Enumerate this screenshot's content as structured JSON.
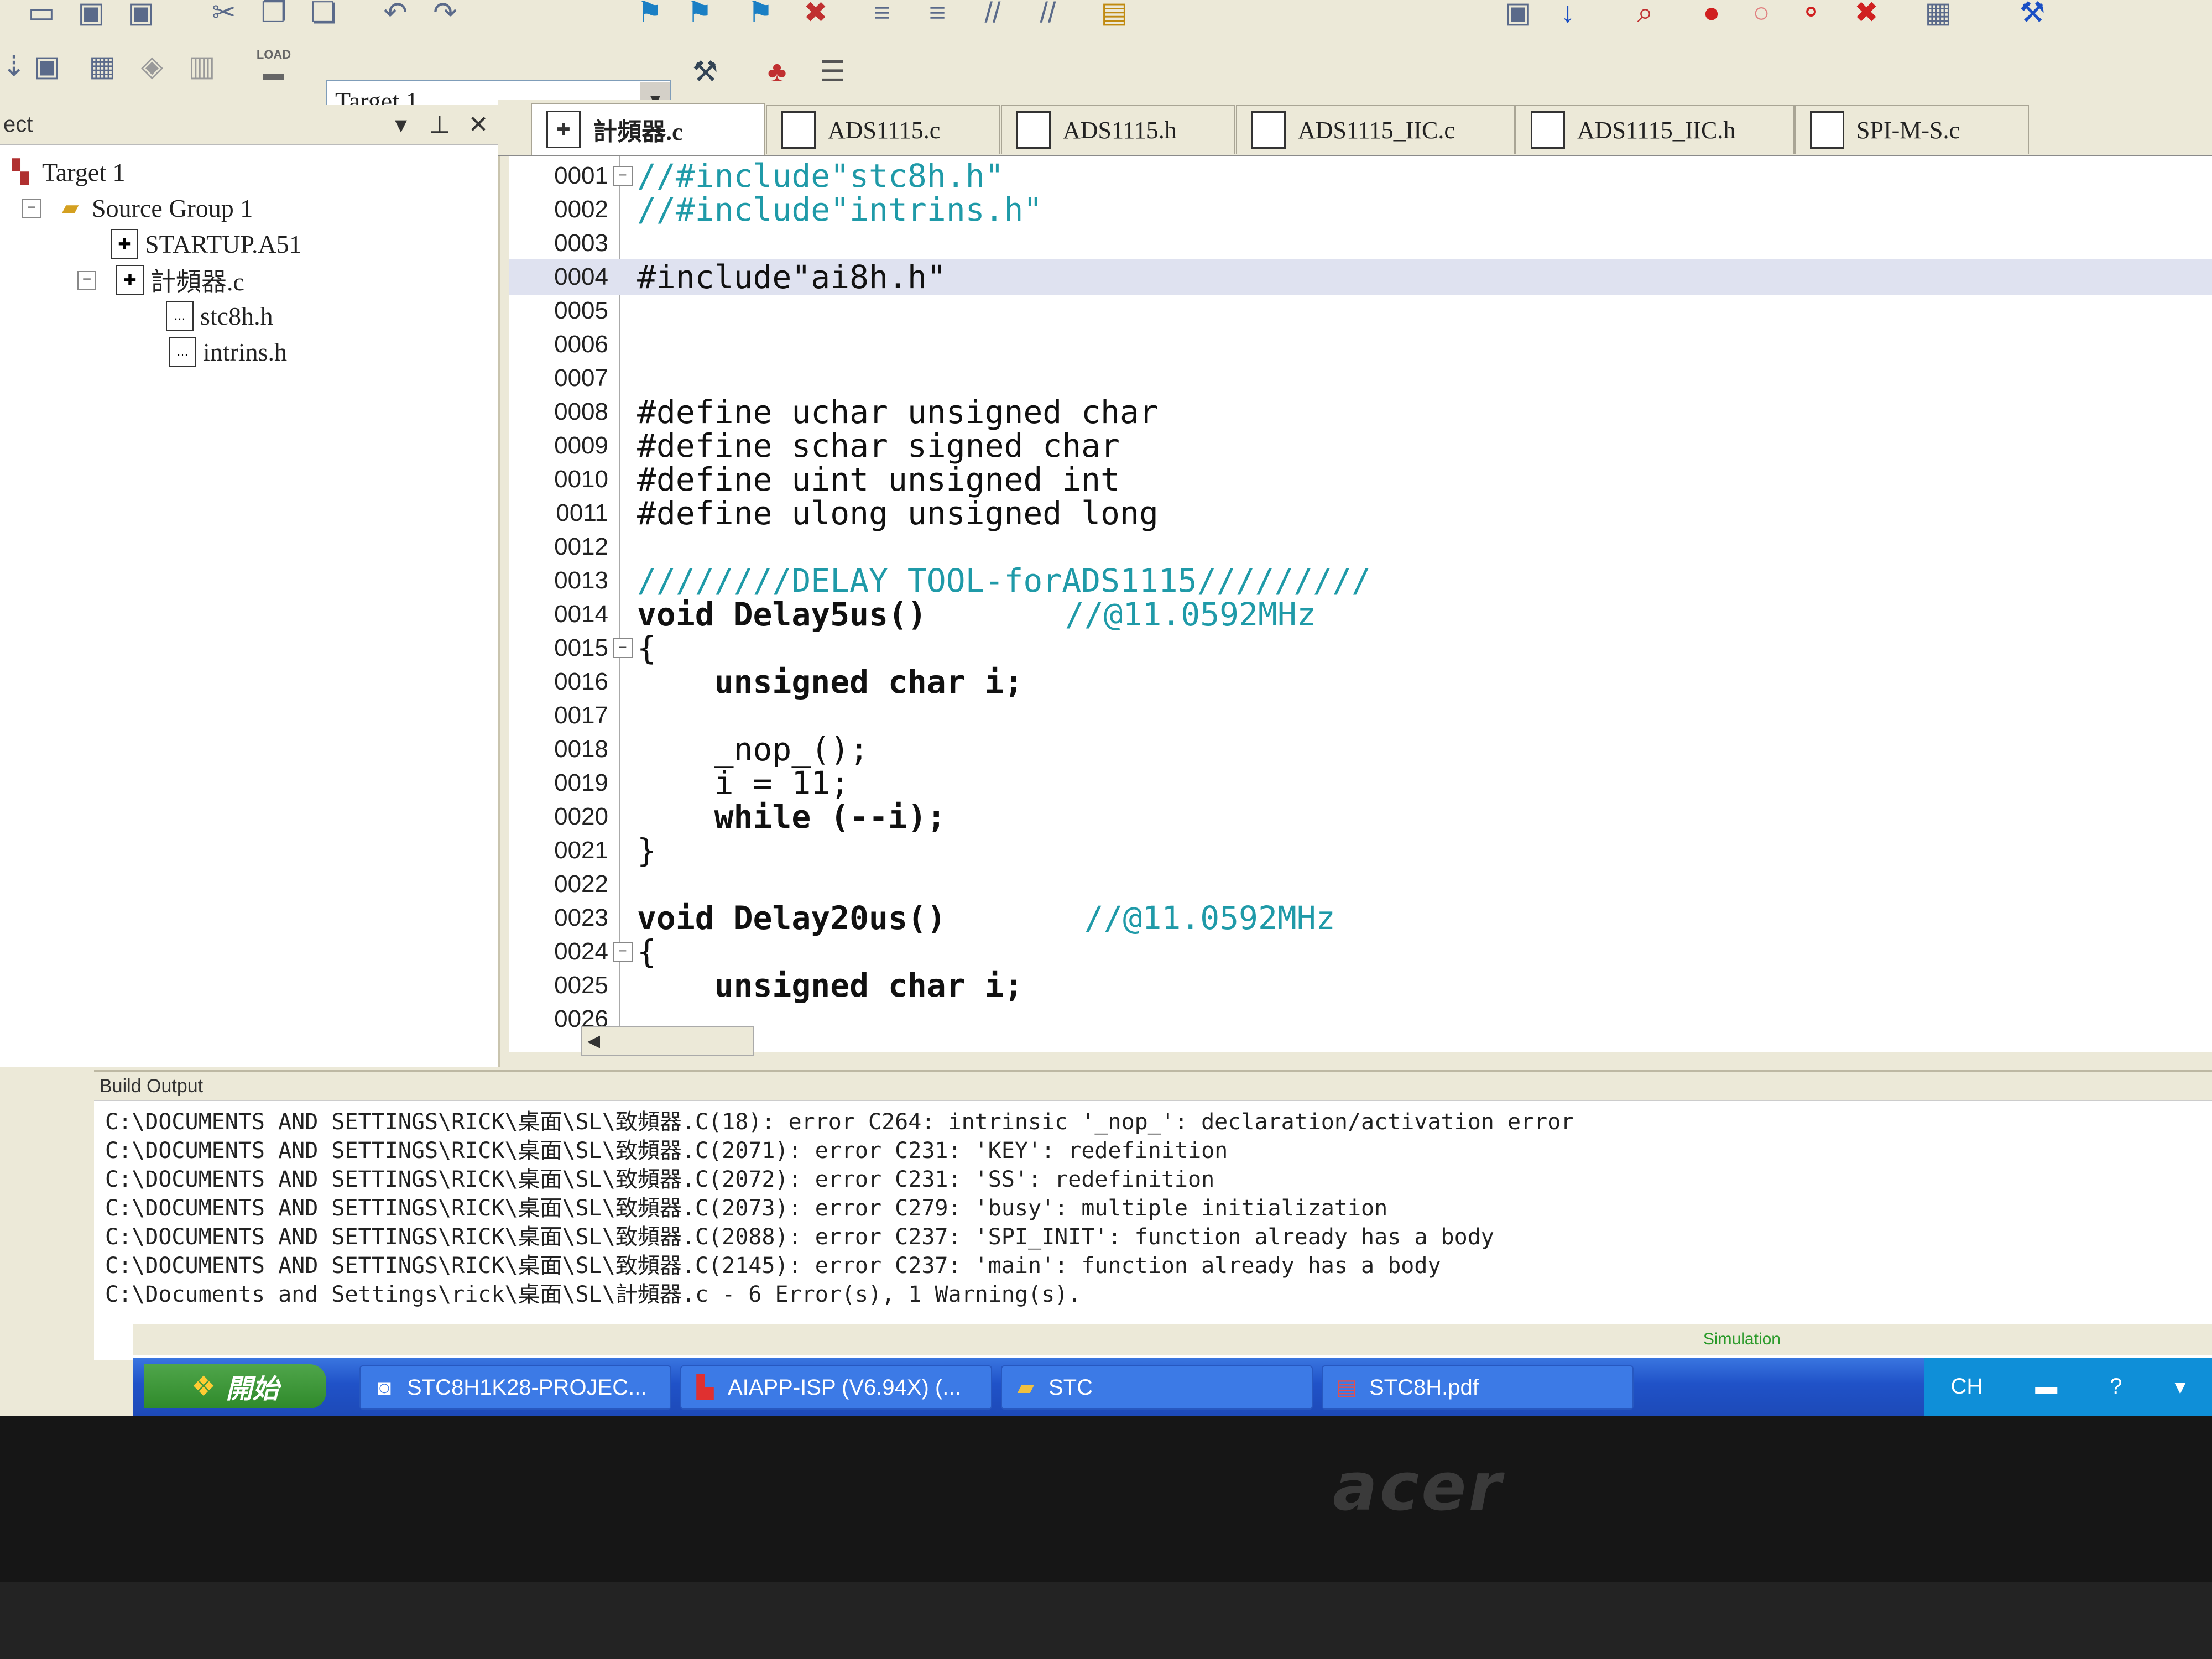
{
  "monitor": {
    "brand": "acer"
  },
  "toolbar": {
    "load_label": "LOAD",
    "target": "Target 1"
  },
  "project_panel": {
    "title": "ect",
    "tree": [
      {
        "label": "Target 1",
        "icon": "target-icon"
      },
      {
        "label": "Source Group 1",
        "icon": "folder-icon"
      },
      {
        "label": "STARTUP.A51",
        "icon": "file-icon"
      },
      {
        "label": "計頻器.c",
        "icon": "file-icon"
      },
      {
        "label": "stc8h.h",
        "icon": "header-file-icon"
      },
      {
        "label": "intrins.h",
        "icon": "header-file-icon"
      }
    ]
  },
  "tabs": [
    {
      "label": "計頻器.c",
      "active": true
    },
    {
      "label": "ADS1115.c",
      "active": false
    },
    {
      "label": "ADS1115.h",
      "active": false
    },
    {
      "label": "ADS1115_IIC.c",
      "active": false
    },
    {
      "label": "ADS1115_IIC.h",
      "active": false
    },
    {
      "label": "SPI-M-S.c",
      "active": false
    }
  ],
  "code_lines": [
    {
      "num": "0001",
      "text": "//#include\"stc8h.h\""
    },
    {
      "num": "0002",
      "text": "//#include\"intrins.h\""
    },
    {
      "num": "0003",
      "text": ""
    },
    {
      "num": "0004",
      "text": "#include\"ai8h.h\""
    },
    {
      "num": "0005",
      "text": ""
    },
    {
      "num": "0006",
      "text": ""
    },
    {
      "num": "0007",
      "text": ""
    },
    {
      "num": "0008",
      "text": "#define uchar unsigned char"
    },
    {
      "num": "0009",
      "text": "#define schar signed char"
    },
    {
      "num": "0010",
      "text": "#define uint unsigned int"
    },
    {
      "num": "0011",
      "text": "#define ulong unsigned long"
    },
    {
      "num": "0012",
      "text": ""
    },
    {
      "num": "0013",
      "text": "////////DELAY TOOL-forADS1115/////////"
    },
    {
      "num": "0014",
      "text": "void Delay5us()",
      "comment": "//@11.0592MHz"
    },
    {
      "num": "0015",
      "text": "{"
    },
    {
      "num": "0016",
      "text": "    unsigned char i;"
    },
    {
      "num": "0017",
      "text": ""
    },
    {
      "num": "0018",
      "text": "    _nop_();"
    },
    {
      "num": "0019",
      "text": "    i = 11;"
    },
    {
      "num": "0020",
      "text": "    while (--i);"
    },
    {
      "num": "0021",
      "text": "}"
    },
    {
      "num": "0022",
      "text": ""
    },
    {
      "num": "0023",
      "text": "void Delay20us()",
      "comment": "//@11.0592MHz"
    },
    {
      "num": "0024",
      "text": "{"
    },
    {
      "num": "0025",
      "text": "    unsigned char i;"
    },
    {
      "num": "0026",
      "text": ""
    }
  ],
  "build_output": {
    "title": "Build Output",
    "lines": [
      "C:\\DOCUMENTS AND SETTINGS\\RICK\\桌面\\SL\\致頻器.C(18): error C264: intrinsic '_nop_': declaration/activation error",
      "C:\\DOCUMENTS AND SETTINGS\\RICK\\桌面\\SL\\致頻器.C(2071): error C231: 'KEY': redefinition",
      "C:\\DOCUMENTS AND SETTINGS\\RICK\\桌面\\SL\\致頻器.C(2072): error C231: 'SS': redefinition",
      "C:\\DOCUMENTS AND SETTINGS\\RICK\\桌面\\SL\\致頻器.C(2073): error C279: 'busy': multiple initialization",
      "C:\\DOCUMENTS AND SETTINGS\\RICK\\桌面\\SL\\致頻器.C(2088): error C237: 'SPI_INIT': function already has a body",
      "C:\\DOCUMENTS AND SETTINGS\\RICK\\桌面\\SL\\致頻器.C(2145): error C237: 'main': function already has a body",
      "C:\\Documents and Settings\\rick\\桌面\\SL\\計頻器.c - 6 Error(s), 1 Warning(s)."
    ]
  },
  "status_bar": {
    "mode": "Simulation"
  },
  "taskbar": {
    "start_label": "開始",
    "tasks": [
      {
        "label": "STC8H1K28-PROJEC...",
        "icon": "keil-icon"
      },
      {
        "label": "AIAPP-ISP (V6.94X) (...",
        "icon": "isp-icon"
      },
      {
        "label": "STC",
        "icon": "folder-icon"
      },
      {
        "label": "STC8H.pdf",
        "icon": "pdf-icon"
      }
    ],
    "tray": {
      "lang": "CH"
    }
  }
}
